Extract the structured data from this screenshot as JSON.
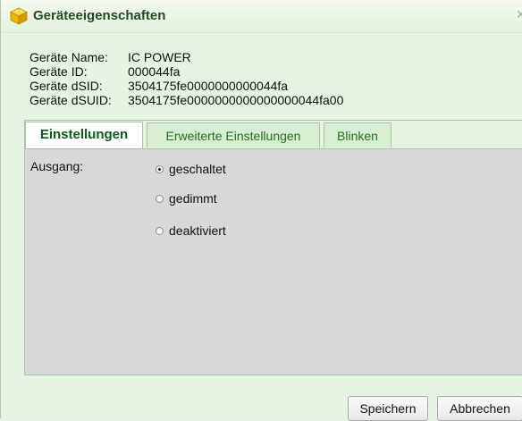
{
  "window": {
    "title": "Geräteeigenschaften",
    "icon": "cube-icon"
  },
  "info": {
    "name_label": "Geräte Name:",
    "name_value": "IC POWER",
    "id_label": "Geräte ID:",
    "id_value": "000044fa",
    "dsid_label": "Geräte dSID:",
    "dsid_value": "3504175fe0000000000044fa",
    "dsuid_label": "Geräte dSUID:",
    "dsuid_value": "3504175fe0000000000000000044fa00"
  },
  "tabs": [
    {
      "label": "Einstellungen",
      "active": true
    },
    {
      "label": "Erweiterte Einstellungen",
      "active": false
    },
    {
      "label": "Blinken",
      "active": false
    }
  ],
  "settings": {
    "output_label": "Ausgang:",
    "options": [
      {
        "label": "geschaltet",
        "selected": true
      },
      {
        "label": "gedimmt",
        "selected": false
      },
      {
        "label": "deaktiviert",
        "selected": false
      }
    ]
  },
  "buttons": {
    "save": "Speichern",
    "cancel": "Abbrechen"
  },
  "colors": {
    "accent": "#0d5b1c",
    "window_bg": "#e6f3e2",
    "panel_bg": "#d8d8d8"
  }
}
